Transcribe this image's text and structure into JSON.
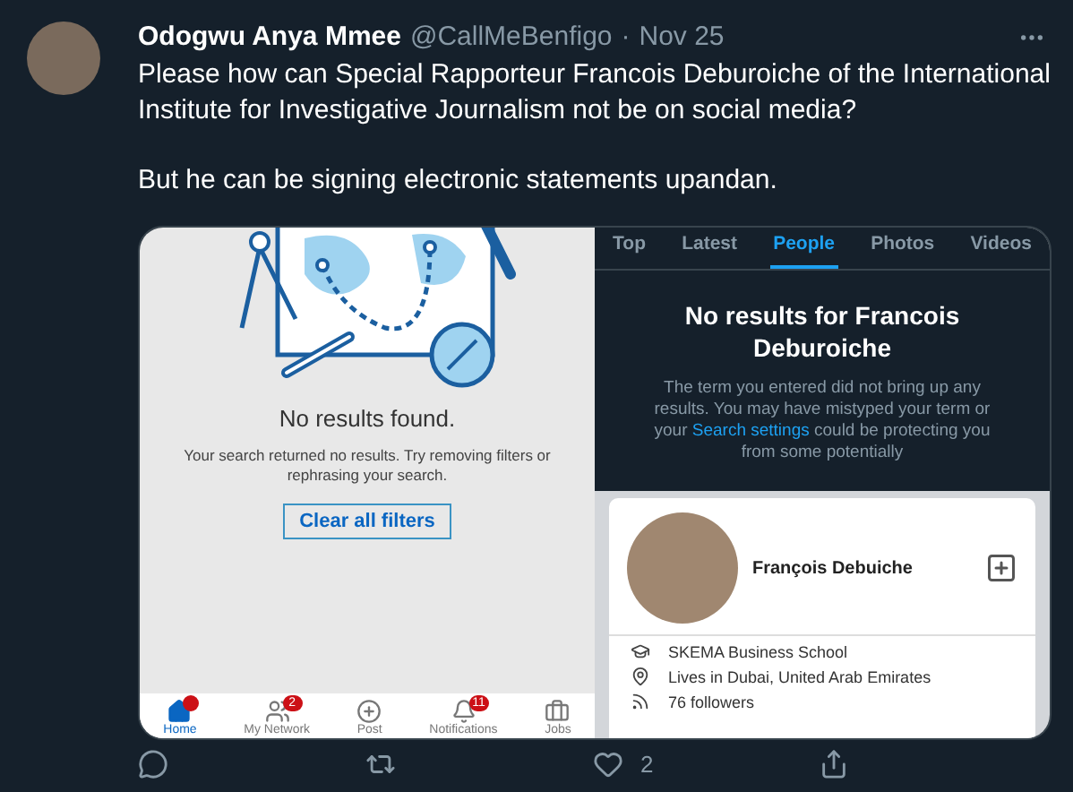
{
  "tweet": {
    "author": {
      "name": "Odogwu Anya Mmee",
      "handle": "@CallMeBenfigo",
      "separator": "·",
      "date": "Nov 25"
    },
    "paragraphs": [
      "Please how can Special Rapporteur Francois Deburoiche of the International Institute for Investigative Journalism not be on social media?",
      "But he can be signing electronic statements upandan."
    ]
  },
  "left_screenshot": {
    "title": "No results found.",
    "message": "Your search returned no results. Try removing filters or rephrasing your search.",
    "button": "Clear all filters",
    "nav": [
      {
        "label": "Home",
        "selected": true,
        "dot": true
      },
      {
        "label": "My Network",
        "selected": false,
        "badge": "2"
      },
      {
        "label": "Post",
        "selected": false
      },
      {
        "label": "Notifications",
        "selected": false,
        "badge": "11"
      },
      {
        "label": "Jobs",
        "selected": false
      }
    ]
  },
  "right_screenshot": {
    "tabs": [
      {
        "label": "Top",
        "selected": false
      },
      {
        "label": "Latest",
        "selected": false
      },
      {
        "label": "People",
        "selected": true
      },
      {
        "label": "Photos",
        "selected": false
      },
      {
        "label": "Videos",
        "selected": false
      }
    ],
    "title": "No results for Francois Deburoiche",
    "message_before": "The term you entered did not bring up any results. You may have mistyped your term or your ",
    "link": "Search settings",
    "message_after": " could be protecting you from some potentially",
    "profile": {
      "name": "François Debuiche",
      "details": [
        {
          "kind": "school",
          "text": "SKEMA Business School"
        },
        {
          "kind": "location",
          "text": "Lives in Dubai, United Arab Emirates"
        },
        {
          "kind": "followers",
          "text": "76 followers"
        }
      ]
    }
  },
  "actions": [
    {
      "kind": "reply"
    },
    {
      "kind": "retweet"
    },
    {
      "kind": "like",
      "count": "2"
    },
    {
      "kind": "share"
    }
  ]
}
